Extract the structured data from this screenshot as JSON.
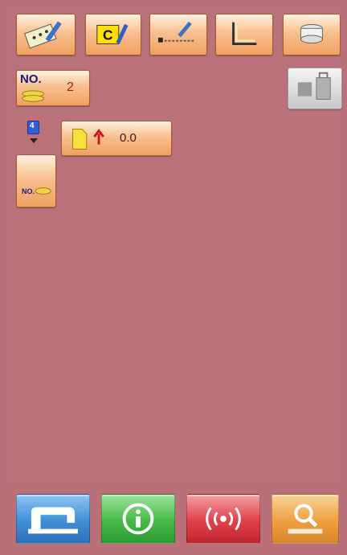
{
  "toolbar": {
    "icons": [
      "pattern-edit-icon",
      "copy-c-icon",
      "pattern-input-icon",
      "coordinate-icon",
      "thread-spool-icon"
    ]
  },
  "pattern_number": {
    "label": "NO.",
    "value": "2"
  },
  "step": {
    "indicator": "4",
    "value": "0.0"
  },
  "no_button_label": "NO.",
  "bottom_bar": {
    "icons": [
      "sewing-machine-icon",
      "info-icon",
      "communication-icon",
      "search-icon"
    ],
    "colors": [
      "#3f8fd8",
      "#45b94a",
      "#e0404a",
      "#f0a040"
    ]
  },
  "colors": {
    "background": "#b9707a",
    "button": "#f8c090"
  }
}
